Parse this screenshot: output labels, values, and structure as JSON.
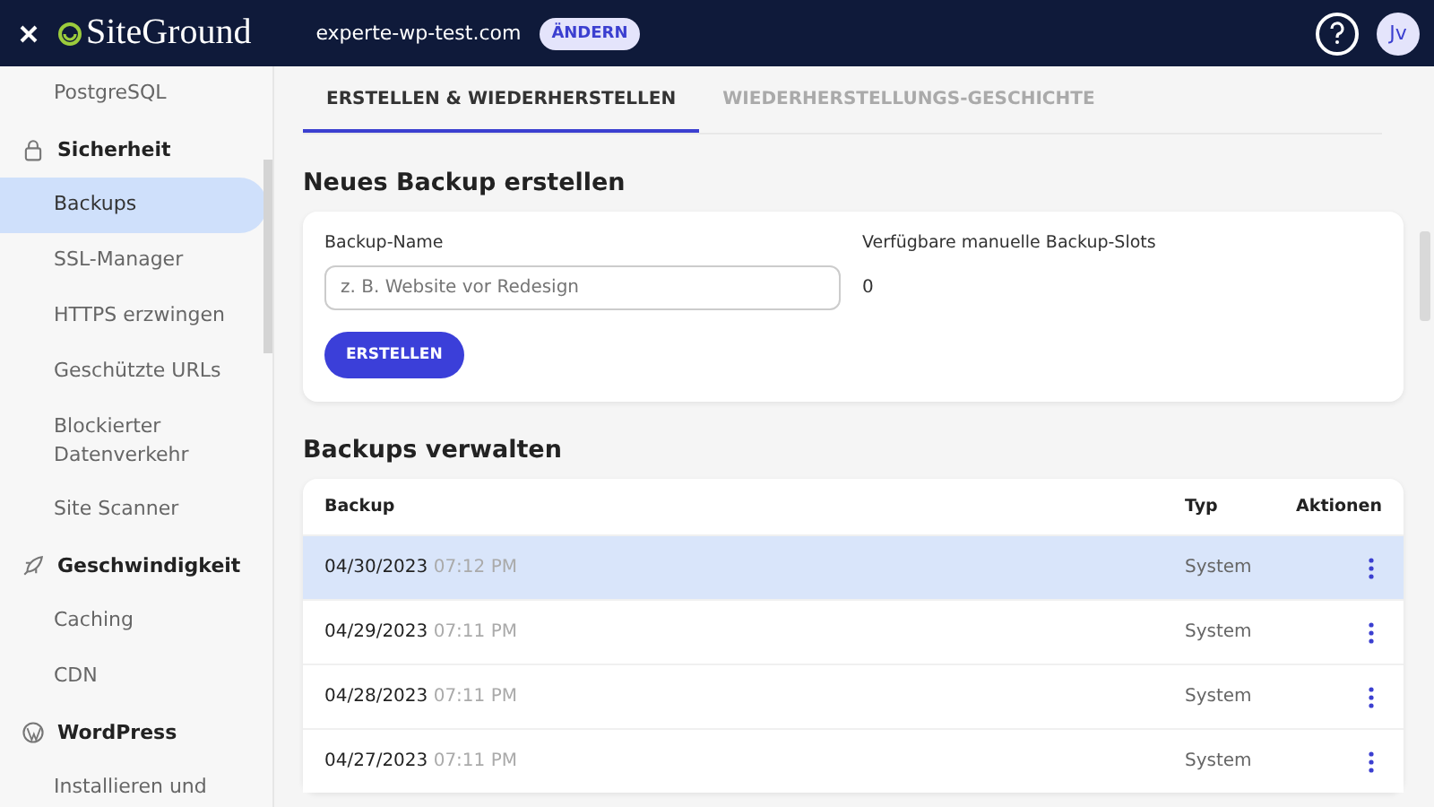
{
  "header": {
    "logo": "SiteGround",
    "site": "experte-wp-test.com",
    "change_button": "ÄNDERN",
    "avatar": "Jv"
  },
  "sidebar": {
    "items": [
      {
        "label": "PostgreSQL",
        "selected": false
      },
      {
        "label": "Sicherheit",
        "children": [
          {
            "label": "Backups",
            "selected": true
          },
          {
            "label": "SSL-Manager",
            "selected": false
          },
          {
            "label": "HTTPS erzwingen",
            "selected": false
          },
          {
            "label": "Geschützte URLs",
            "selected": false
          },
          {
            "label": "Blockierter Datenverkehr",
            "selected": false
          },
          {
            "label": "Site Scanner",
            "selected": false
          }
        ]
      },
      {
        "label": "Geschwindigkeit",
        "children": [
          {
            "label": "Caching",
            "selected": false
          },
          {
            "label": "CDN",
            "selected": false
          }
        ]
      },
      {
        "label": "WordPress",
        "children": [
          {
            "label": "Installieren und",
            "selected": false
          }
        ]
      }
    ]
  },
  "tabs": [
    {
      "label": "ERSTELLEN & WIEDERHERSTELLEN",
      "selected": true
    },
    {
      "label": "WIEDERHERSTELLUNGS-GESCHICHTE",
      "selected": false
    }
  ],
  "create": {
    "title": "Neues Backup erstellen",
    "name_label": "Backup-Name",
    "placeholder": "z. B. Website vor Redesign",
    "slots_label": "Verfügbare manuelle Backup-Slots",
    "slots_value": "0",
    "button": "ERSTELLEN"
  },
  "manage": {
    "title": "Backups verwalten",
    "columns": [
      "Backup",
      "Typ",
      "Aktionen"
    ],
    "rows": [
      {
        "date": "04/30/2023",
        "time": "07:12 PM",
        "type": "System",
        "selected": true
      },
      {
        "date": "04/29/2023",
        "time": "07:11 PM",
        "type": "System",
        "selected": false
      },
      {
        "date": "04/28/2023",
        "time": "07:11 PM",
        "type": "System",
        "selected": false
      },
      {
        "date": "04/27/2023",
        "time": "07:11 PM",
        "type": "System",
        "selected": false
      }
    ]
  }
}
